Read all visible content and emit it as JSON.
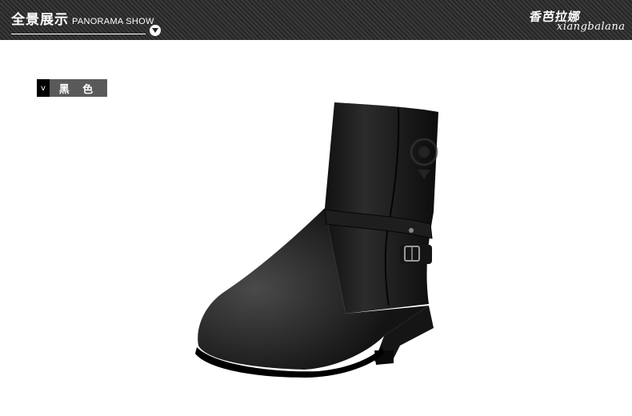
{
  "header": {
    "title_cn": "全景展示",
    "title_en": "PANORAMA SHOW",
    "brand_cn": "香芭拉娜",
    "brand_en": "xiangbalana",
    "icon": "chevron-down-icon"
  },
  "color_tag": {
    "marker": "v",
    "label": "黑 色"
  },
  "product": {
    "image": "black-mid-calf-boot"
  }
}
